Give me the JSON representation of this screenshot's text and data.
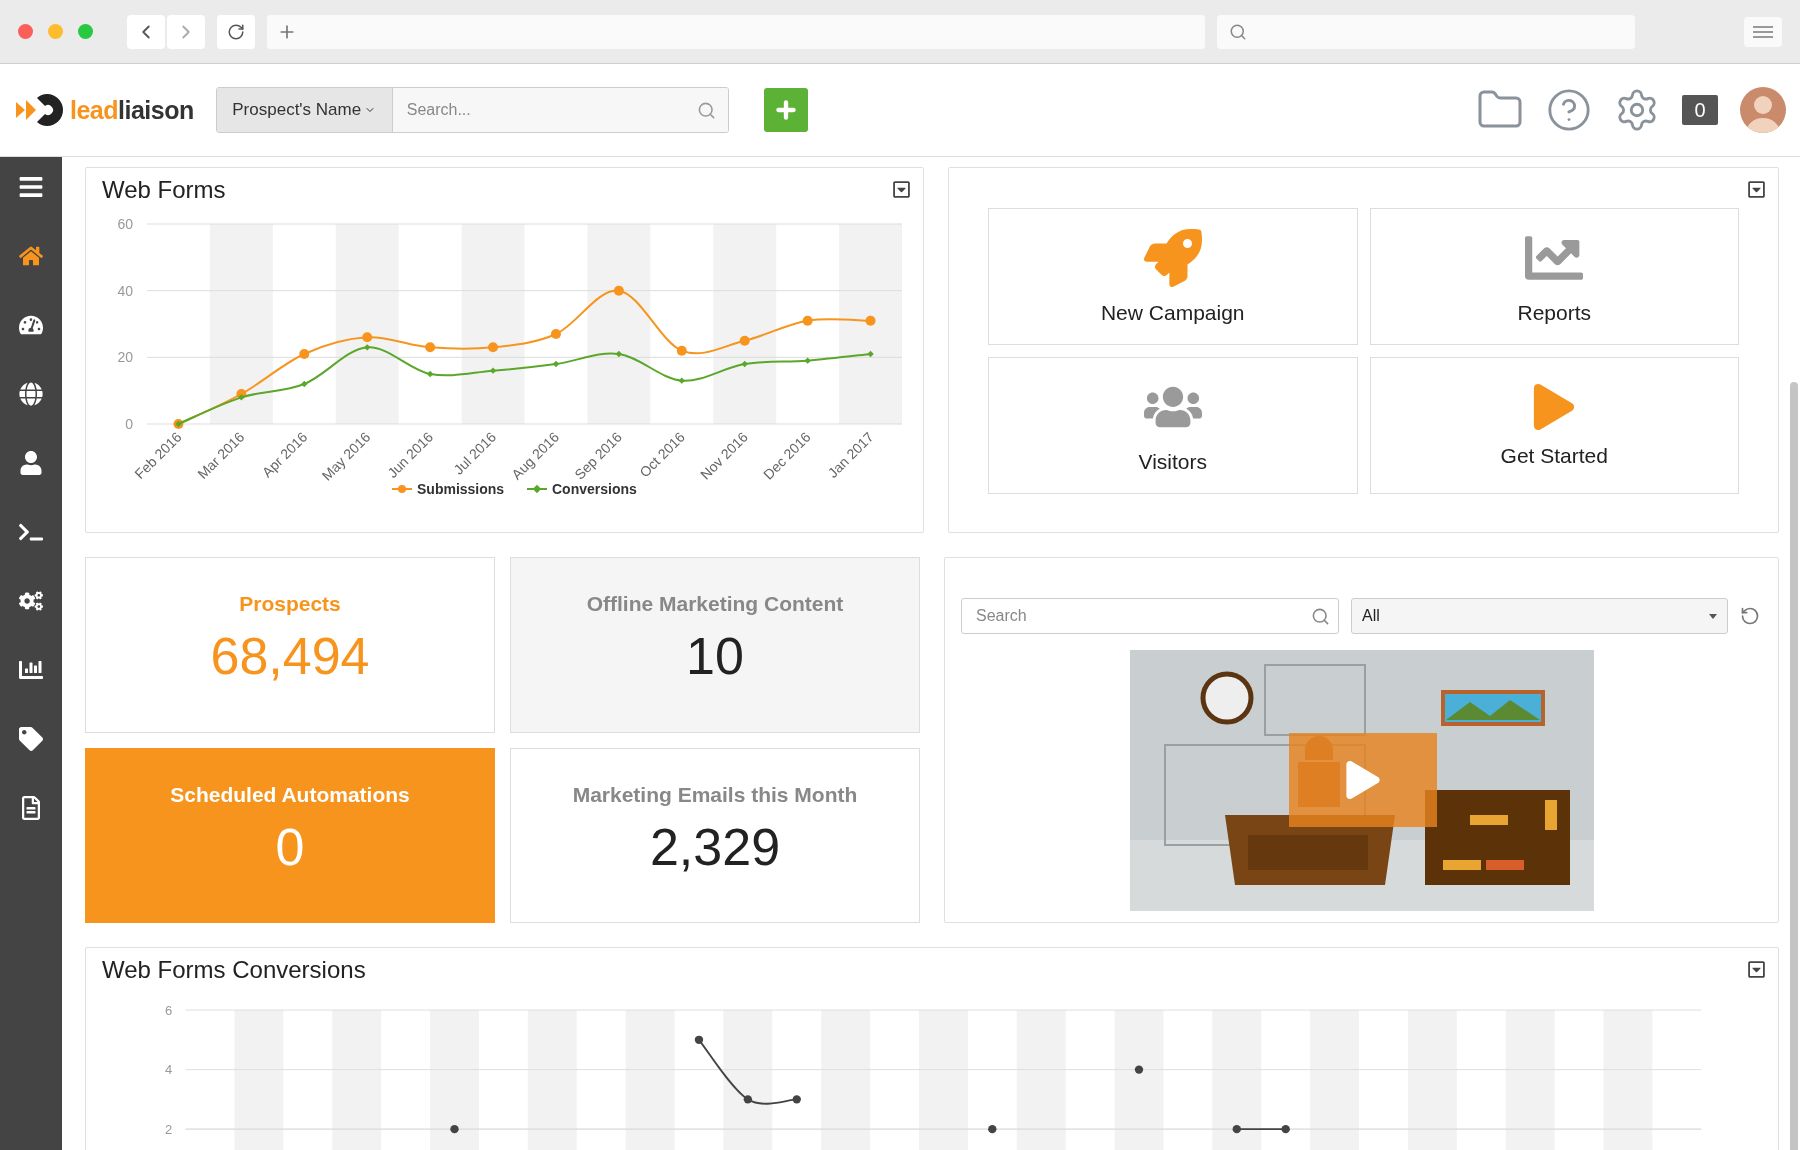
{
  "header": {
    "logo": {
      "first": "lead",
      "second": "liaison"
    },
    "search": {
      "scope": "Prospect's Name",
      "placeholder": "Search..."
    },
    "notifications": "0"
  },
  "sidebar": {
    "items": [
      {
        "selected": true
      },
      {
        "selected": false
      },
      {
        "selected": false
      },
      {
        "selected": false
      },
      {
        "selected": false
      },
      {
        "selected": false
      },
      {
        "selected": false
      },
      {
        "selected": false
      },
      {
        "selected": false
      }
    ]
  },
  "web_forms": {
    "title": "Web Forms",
    "chart_data": {
      "type": "line",
      "categories": [
        "Feb 2016",
        "Mar 2016",
        "Apr 2016",
        "May 2016",
        "Jun 2016",
        "Jul 2016",
        "Aug 2016",
        "Sep 2016",
        "Oct 2016",
        "Nov 2016",
        "Dec 2016",
        "Jan 2017"
      ],
      "ylim": [
        0,
        60
      ],
      "yticks": [
        0,
        20,
        40,
        60
      ],
      "legend": true,
      "series": [
        {
          "name": "Submissions",
          "color": "#f7941d",
          "marker": "circle",
          "values": [
            0,
            9,
            21,
            26,
            23,
            23,
            27,
            40,
            22,
            25,
            31,
            31
          ]
        },
        {
          "name": "Conversions",
          "color": "#5aa72b",
          "marker": "diamond",
          "values": [
            0,
            8,
            12,
            23,
            15,
            16,
            18,
            21,
            13,
            18,
            19,
            21
          ]
        }
      ]
    }
  },
  "quick_links": [
    {
      "label": "New Campaign"
    },
    {
      "label": "Reports"
    },
    {
      "label": "Visitors"
    },
    {
      "label": "Get Started"
    }
  ],
  "stats": [
    {
      "kind": "highlight",
      "label": "Prospects",
      "value": "68,494"
    },
    {
      "kind": "muted",
      "label": "Offline Marketing Content",
      "value": "10"
    },
    {
      "kind": "filled",
      "label": "Scheduled Automations",
      "value": "0"
    },
    {
      "kind": "plain",
      "label": "Marketing Emails this Month",
      "value": "2,329"
    }
  ],
  "videos": {
    "search": {
      "placeholder": "Search"
    },
    "filter": {
      "value": "All"
    }
  },
  "conversions": {
    "title": "Web Forms Conversions",
    "chart_data": {
      "type": "line",
      "ylim": [
        2,
        6
      ],
      "yticks": [
        2,
        4,
        6
      ],
      "series": [
        {
          "color": "#444444",
          "marker": "circle",
          "values": [
            null,
            null,
            null,
            null,
            null,
            2,
            null,
            null,
            null,
            null,
            5,
            3,
            3,
            null,
            null,
            null,
            2,
            null,
            null,
            4,
            null,
            2,
            2,
            null,
            null,
            null,
            null,
            null,
            null,
            null,
            null
          ]
        }
      ]
    }
  }
}
